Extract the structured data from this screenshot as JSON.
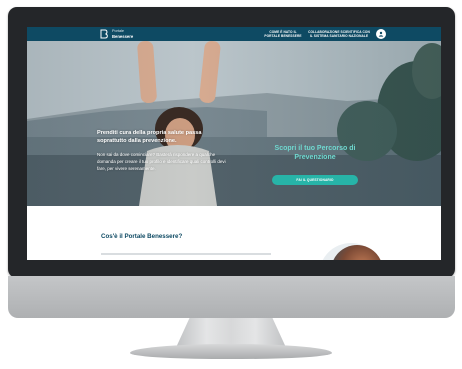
{
  "header": {
    "logo_name": "Portale",
    "logo_subname": "Benessere",
    "nav_items": [
      "COME È NATO IL\nPORTALE BENESSERE",
      "COLLABORAZIONE SCIENTIFICA CON\nIL SISTEMA SANITARIO NAZIONALE"
    ]
  },
  "hero": {
    "headline": "Prenditi cura della propria salute passa soprattutto dalla prevenzione.",
    "body": "Non sai da dove cominciare? Basterà rispondere a qualche domanda per creare il tuo profilo e identificare quali controlli devi fare, per vivere serenamente.",
    "cta_title": "Scopri il tuo Percorso di Prevenzione",
    "cta_button": "FAI IL QUESTIONARIO"
  },
  "section": {
    "title": "Cos'è il Portale Benessere?"
  },
  "colors": {
    "header": "#0e4a63",
    "accent": "#27b4a8",
    "accent_text": "#6fd8cf",
    "section_title": "#0e4a63"
  },
  "icons": {
    "logo": "portale-benessere-logo-icon",
    "user": "user-icon"
  }
}
